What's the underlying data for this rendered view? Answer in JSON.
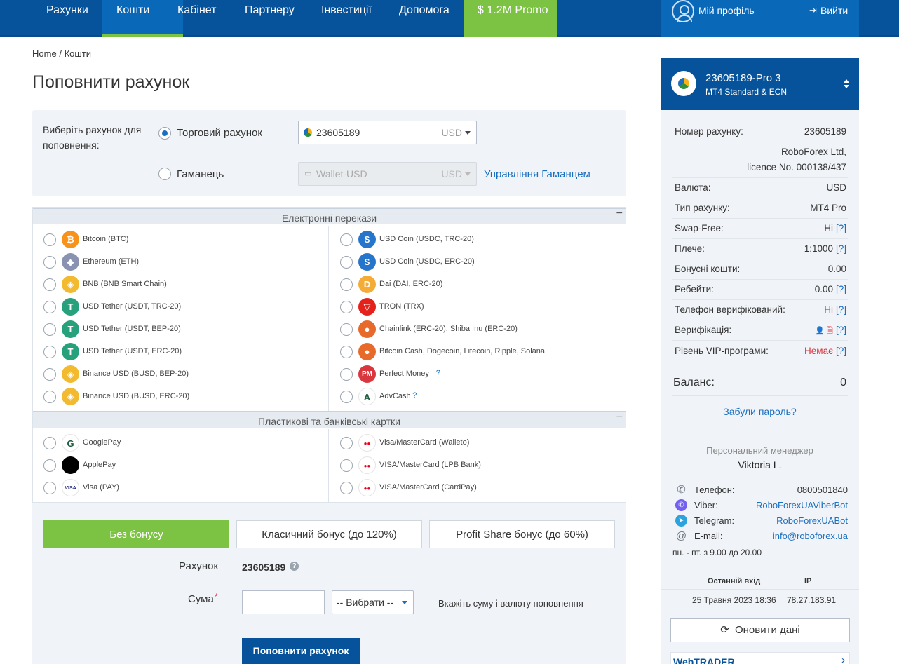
{
  "nav": {
    "items": [
      "Рахунки",
      "Кошти",
      "Кабінет",
      "Партнеру",
      "Інвестиції",
      "Допомога"
    ],
    "promo": "$ 1.2M Promo",
    "profile": "Мій профіль",
    "logout": "Вийти"
  },
  "breadcrumb": {
    "home": "Home",
    "sep": "/",
    "current": "Кошти"
  },
  "title": "Поповнити рахунок",
  "choose": {
    "label": "Виберіть рахунок для поповнення:",
    "trading_label": "Торговий рахунок",
    "trading_account": "23605189",
    "trading_currency": "USD",
    "wallet_label": "Гаманець",
    "wallet_value": "Wallet-USD",
    "wallet_currency": "USD",
    "wallet_manage": "Управління Гаманцем"
  },
  "sections": {
    "electronic": "Електронні перекази",
    "cards": "Пластикові та банківські картки",
    "collapse": "−"
  },
  "electronic_left": [
    {
      "label": "Bitcoin (BTC)",
      "icon": "bitcoin-icon",
      "color": "#f7931a",
      "glyph": "₿"
    },
    {
      "label": "Ethereum (ETH)",
      "icon": "ethereum-icon",
      "color": "#8a92b2",
      "glyph": "◆"
    },
    {
      "label": "BNB (BNB Smart Chain)",
      "icon": "bnb-icon",
      "color": "#f3ba2f",
      "glyph": "◈"
    },
    {
      "label": "USD Tether (USDT, TRC-20)",
      "icon": "tether-icon",
      "color": "#26a17b",
      "glyph": "T"
    },
    {
      "label": "USD Tether (USDT, BEP-20)",
      "icon": "tether-icon",
      "color": "#26a17b",
      "glyph": "T"
    },
    {
      "label": "USD Tether (USDT, ERC-20)",
      "icon": "tether-icon",
      "color": "#26a17b",
      "glyph": "T"
    },
    {
      "label": "Binance USD (BUSD, BEP-20)",
      "icon": "busd-icon",
      "color": "#f3ba2f",
      "glyph": "◈"
    },
    {
      "label": "Binance USD (BUSD, ERC-20)",
      "icon": "busd-icon",
      "color": "#f3ba2f",
      "glyph": "◈"
    }
  ],
  "electronic_right": [
    {
      "label": "USD Coin (USDC, TRC-20)",
      "icon": "usdc-icon",
      "color": "#2775ca",
      "glyph": "$"
    },
    {
      "label": "USD Coin (USDC, ERC-20)",
      "icon": "usdc-icon",
      "color": "#2775ca",
      "glyph": "$"
    },
    {
      "label": "Dai (DAI, ERC-20)",
      "icon": "dai-icon",
      "color": "#f5ac37",
      "glyph": "D"
    },
    {
      "label": "TRON (TRX)",
      "icon": "tron-icon",
      "color": "#e4221b",
      "glyph": "▽"
    },
    {
      "label": "Chainlink (ERC-20), Shiba Inu (ERC-20)",
      "icon": "multi-coin-icon",
      "color": "#e86a2b",
      "glyph": "●"
    },
    {
      "label": "Bitcoin Cash, Dogecoin, Litecoin, Ripple, Solana",
      "icon": "multi-coin-icon",
      "color": "#e86a2b",
      "glyph": "●"
    },
    {
      "label": "Perfect Money",
      "icon": "perfect-money-icon",
      "color": "#d9363e",
      "glyph": "PM",
      "help": "?"
    },
    {
      "label": "AdvCash",
      "icon": "advcash-icon",
      "color": "#ffffff",
      "glyph": "A",
      "help": "?"
    }
  ],
  "cards_left": [
    {
      "label": "GooglePay",
      "icon": "google-pay-icon",
      "color": "#ffffff",
      "glyph": "G"
    },
    {
      "label": "ApplePay",
      "icon": "apple-pay-icon",
      "color": "#000000",
      "glyph": ""
    },
    {
      "label": "Visa (PAY)",
      "icon": "visa-icon",
      "color": "#ffffff",
      "glyph": "VISA"
    }
  ],
  "cards_right": [
    {
      "label": "Visa/MasterCard (Walleto)",
      "icon": "mastercard-icon",
      "color": "#ffffff",
      "glyph": "●●"
    },
    {
      "label": "VISA/MasterCard (LPB Bank)",
      "icon": "mastercard-icon",
      "color": "#ffffff",
      "glyph": "●●"
    },
    {
      "label": "VISA/MasterCard (CardPay)",
      "icon": "mastercard-icon",
      "color": "#ffffff",
      "glyph": "●●"
    }
  ],
  "bonus": {
    "none": "Без бонусу",
    "classic": "Класичний бонус (до 120%)",
    "profit": "Profit Share бонус (до 60%)"
  },
  "form": {
    "account_label": "Рахунок",
    "account_value": "23605189",
    "amount_label": "Сума",
    "required": "*",
    "amount_value": "",
    "currency_select": "-- Вибрати --",
    "hint": "Вкажіть суму і валюту поповнення",
    "submit": "Поповнити рахунок"
  },
  "account": {
    "title": "23605189-Pro 3",
    "subtitle": "MT4 Standard & ECN",
    "rows": [
      {
        "k": "Номер рахунку:",
        "v": "23605189"
      },
      {
        "k": "Валюта:",
        "v": "USD"
      },
      {
        "k": "Тип рахунку:",
        "v": "MT4 Pro"
      },
      {
        "k": "Swap-Free:",
        "v": "Ні",
        "help": "[?]"
      },
      {
        "k": "Плече:",
        "v": "1:1000",
        "help": "[?]"
      },
      {
        "k": "Бонусні кошти:",
        "v": "0.00"
      },
      {
        "k": "Ребейти:",
        "v": "0.00",
        "help": "[?]"
      },
      {
        "k": "Телефон верифікований:",
        "v": "Ні",
        "help": "[?]",
        "red": true
      },
      {
        "k": "Верифікація:",
        "v": "",
        "help": "[?]"
      },
      {
        "k": "Рівень VIP-програми:",
        "v": "Немає",
        "help": "[?]",
        "red": true
      }
    ],
    "company": "RoboForex Ltd,",
    "licence": "licence No. 000138/437",
    "balance_label": "Баланс:",
    "balance_value": "0",
    "forgot": "Забули пароль?",
    "manager_label": "Персональний менеджер",
    "manager_name": "Viktoria L.",
    "contacts": [
      {
        "k": "Телефон:",
        "v": "0800501840",
        "icon": "phone-icon",
        "link": false
      },
      {
        "k": "Viber:",
        "v": "RoboForexUAViberBot",
        "icon": "viber-icon",
        "link": true
      },
      {
        "k": "Telegram:",
        "v": "RoboForexUABot",
        "icon": "telegram-icon",
        "link": true
      },
      {
        "k": "E-mail:",
        "v": "info@roboforex.ua",
        "icon": "email-icon",
        "link": true
      }
    ],
    "hours": "пн. - пт. з 9.00 до 20.00",
    "last_login_label": "Останній вхід",
    "ip_label": "IP",
    "last_login": "25 Травня 2023 18:36",
    "ip": "78.27.183.91",
    "refresh": "Оновити дані",
    "webtrader": "WebTRADER"
  },
  "colors": {
    "nav_bg": "#07539b",
    "nav_active": "#0a68b8",
    "accent_green": "#7cc243",
    "link_blue": "#1a6fc0",
    "panel_bg": "#f0f3f7",
    "warning_red": "#d9363e"
  }
}
